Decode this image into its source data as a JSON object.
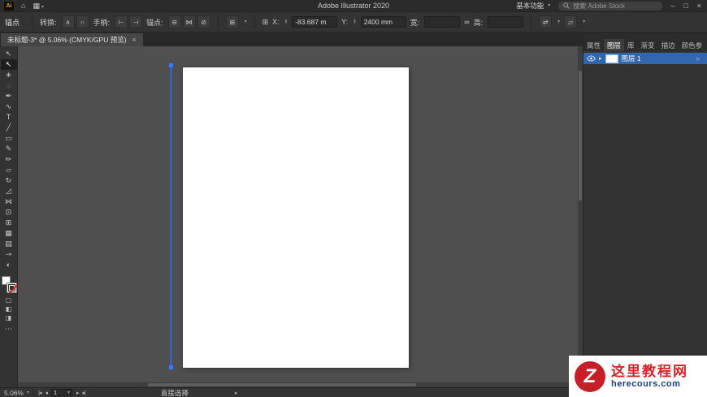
{
  "app": {
    "title": "Adobe Illustrator 2020"
  },
  "colors": {
    "accent_selection_blue": "#3f7bfa",
    "layer_highlight_blue": "#2f66ad",
    "watermark_red": "#d8232a",
    "watermark_blue": "#1f3b8e",
    "panel_background": "#333333",
    "canvas_background": "#4f4f4f"
  },
  "icons": {
    "home": "⌂",
    "arrange_documents": "▦",
    "chevron_down": "▾",
    "spinner_up": "▴",
    "spinner_down": "▾",
    "minimize": "–",
    "restore": "□",
    "close": "×",
    "grid_options": "⊞",
    "reference_point": "⊞",
    "constrain_link": "∞",
    "transform_menu": "⇄",
    "shape_props": "▱",
    "nav_first": "|◂",
    "nav_prev": "◂",
    "nav_next": "▸",
    "nav_last": "▸|",
    "flyout": "▸",
    "layer_expand": "▸",
    "target_circle": "○",
    "overflow": "⋯"
  },
  "titlebar": {
    "logo_text": "Ai",
    "workspace_label": "基本功能",
    "search_placeholder": "搜索 Adobe Stock"
  },
  "controlbar": {
    "context_label": "锚点",
    "groups": [
      {
        "label": "转换:",
        "buttons": [
          {
            "name": "convert-corner-button",
            "glyph": "∧"
          },
          {
            "name": "convert-smooth-button",
            "glyph": "∩"
          }
        ]
      },
      {
        "label": "手柄:",
        "buttons": [
          {
            "name": "handles-show-button",
            "glyph": "⊢"
          },
          {
            "name": "handles-hide-button",
            "glyph": "⊣"
          }
        ]
      },
      {
        "label": "锚点:",
        "buttons": [
          {
            "name": "anchor-delete-button",
            "glyph": "⊖"
          },
          {
            "name": "anchor-connect-button",
            "glyph": "⋈"
          },
          {
            "name": "anchor-cut-button",
            "glyph": "⊘"
          }
        ]
      }
    ],
    "fields": {
      "x_label": "X:",
      "x_value": "-83.687 m",
      "y_label": "Y:",
      "y_value": "2400 mm",
      "width_label": "宽:",
      "width_value": "",
      "height_label": "高:",
      "height_value": ""
    }
  },
  "tabbar": {
    "document_title": "未标题-3* @ 5.06% (CMYK/GPU 预览)"
  },
  "toolbar": {
    "tools": [
      {
        "name": "selection-tool",
        "glyph": "↖"
      },
      {
        "name": "direct-selection-tool",
        "glyph": "↖",
        "active": true
      },
      {
        "name": "magic-wand-tool",
        "glyph": "∗"
      },
      {
        "name": "lasso-tool",
        "glyph": "◌"
      },
      {
        "name": "pen-tool",
        "glyph": "✒"
      },
      {
        "name": "curvature-tool",
        "glyph": "∿"
      },
      {
        "name": "type-tool",
        "glyph": "T"
      },
      {
        "name": "line-segment-tool",
        "glyph": "╱"
      },
      {
        "name": "rectangle-tool",
        "glyph": "▭"
      },
      {
        "name": "paintbrush-tool",
        "glyph": "✎"
      },
      {
        "name": "shaper-tool",
        "glyph": "✏"
      },
      {
        "name": "eraser-tool",
        "glyph": "▱"
      },
      {
        "name": "rotate-tool",
        "glyph": "↻"
      },
      {
        "name": "scale-tool",
        "glyph": "◿"
      },
      {
        "name": "width-tool",
        "glyph": "⋈"
      },
      {
        "name": "free-transform-tool",
        "glyph": "⊡"
      },
      {
        "name": "shape-builder-tool",
        "glyph": "⊞"
      },
      {
        "name": "mesh-tool",
        "glyph": "▦"
      },
      {
        "name": "gradient-tool",
        "glyph": "▤"
      },
      {
        "name": "eyedropper-tool",
        "glyph": "⊸"
      },
      {
        "name": "blend-tool",
        "glyph": "◐"
      }
    ],
    "modes": [
      {
        "name": "draw-normal-button",
        "glyph": "▢"
      },
      {
        "name": "draw-behind-button",
        "glyph": "◧"
      },
      {
        "name": "draw-inside-button",
        "glyph": "◨"
      }
    ]
  },
  "panel": {
    "tabs": [
      {
        "name": "tab-properties",
        "label": "属性"
      },
      {
        "name": "tab-layers",
        "label": "图层",
        "active": true
      },
      {
        "name": "tab-libraries",
        "label": "库"
      },
      {
        "name": "tab-gradient",
        "label": "渐变"
      },
      {
        "name": "tab-stroke",
        "label": "描边"
      },
      {
        "name": "tab-color-guide",
        "label": "颜色参"
      }
    ],
    "layer_name": "图层 1"
  },
  "statusbar": {
    "zoom": "5.06%",
    "artboard_number": "1",
    "tool_name": "直接选择"
  },
  "watermark": {
    "logo": "Z",
    "site": "这里教程网",
    "domain": "herecours.com"
  }
}
